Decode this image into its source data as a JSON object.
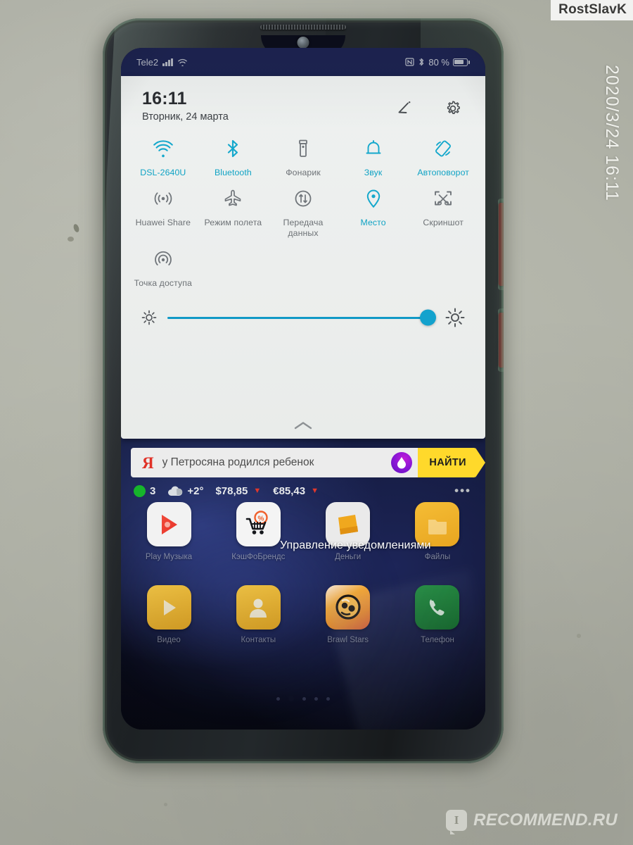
{
  "watermarks": {
    "user": "RostSlavK",
    "timestamp": "2020/3/24  16:11",
    "site": "RECOMMEND.RU",
    "site_logo_letter": "I"
  },
  "statusbar": {
    "carrier": "Tele2",
    "signal_icon": "signal-bars-icon",
    "wifi_icon": "wifi-icon",
    "nfc_icon": "nfc-icon",
    "bluetooth_icon": "bluetooth-icon",
    "battery_percent": "80 %",
    "battery_icon": "battery-icon"
  },
  "quick_settings": {
    "clock": "16:11",
    "date": "Вторник, 24 марта",
    "edit_icon": "edit-pencil-icon",
    "settings_icon": "gear-icon",
    "collapse_icon": "chevron-up-icon",
    "accent_color": "#15a8cc",
    "inactive_color": "#70757a",
    "tiles": [
      {
        "label": "DSL-2640U",
        "icon": "wifi-icon",
        "active": true
      },
      {
        "label": "Bluetooth",
        "icon": "bluetooth-icon",
        "active": true
      },
      {
        "label": "Фонарик",
        "icon": "flashlight-icon",
        "active": false
      },
      {
        "label": "Звук",
        "icon": "bell-icon",
        "active": true
      },
      {
        "label": "Автоповорот",
        "icon": "auto-rotate-icon",
        "active": true
      },
      {
        "label": "Huawei Share",
        "icon": "huawei-share-icon",
        "active": false
      },
      {
        "label": "Режим полета",
        "icon": "airplane-icon",
        "active": false
      },
      {
        "label": "Передача данных",
        "icon": "data-transfer-icon",
        "active": false
      },
      {
        "label": "Место",
        "icon": "location-pin-icon",
        "active": true
      },
      {
        "label": "Скриншот",
        "icon": "screenshot-icon",
        "active": false
      },
      {
        "label": "Точка доступа",
        "icon": "hotspot-icon",
        "active": false
      }
    ],
    "brightness": {
      "low_icon": "sun-small-icon",
      "high_icon": "sun-large-icon",
      "value_percent": 97
    }
  },
  "yandex_widget": {
    "logo": "Я",
    "query": "у Петросяна родился ребенок",
    "alice_icon": "alice-assistant-icon",
    "search_button": "НАЙТИ",
    "search_button_color": "#ffd92b",
    "info": {
      "traffic_value": "3",
      "traffic_icon": "traffic-dot-icon",
      "weather_temp": "+2°",
      "weather_icon": "cloud-icon",
      "usd": "$78,85",
      "usd_trend": "▼",
      "eur": "€85,43",
      "eur_trend": "▼",
      "more_icon": "more-dots-icon"
    }
  },
  "homescreen": {
    "notification_toast": "Управление уведомлениями",
    "apps_row1": [
      {
        "label": "Play Музыка",
        "icon": "play-music-icon",
        "bg": "#f2f2f2"
      },
      {
        "label": "КэшФоБрендс",
        "icon": "shopping-cart-icon",
        "bg": "#f4f4f4"
      },
      {
        "label": "Деньги",
        "icon": "wallet-icon",
        "bg": "#e9e9e9"
      },
      {
        "label": "Файлы",
        "icon": "files-folder-icon",
        "bg": "#f0b429"
      }
    ],
    "apps_row2": [
      {
        "label": "Видео",
        "icon": "video-play-icon",
        "bg": "#e8b830"
      },
      {
        "label": "Контакты",
        "icon": "contacts-icon",
        "bg": "#e8b830"
      },
      {
        "label": "Brawl Stars",
        "icon": "brawl-stars-icon",
        "bg": "#e8a33a"
      },
      {
        "label": "Телефон",
        "icon": "phone-handset-icon",
        "bg": "#1a7a35"
      }
    ],
    "page_dots_count": 5,
    "page_dots_active_index": 1
  }
}
